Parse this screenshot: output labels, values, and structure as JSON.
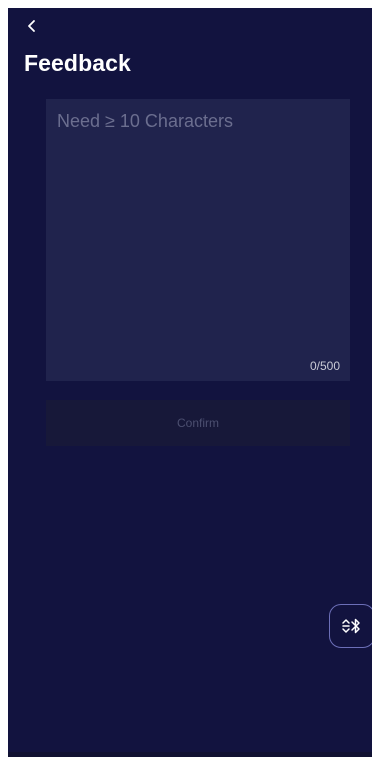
{
  "header": {
    "back_icon": "chevron-left-icon",
    "title": "Feedback"
  },
  "feedback": {
    "placeholder": "Need ≥ 10 Characters",
    "value": "",
    "counter": "0/500"
  },
  "actions": {
    "confirm_label": "Confirm",
    "confirm_enabled": false
  },
  "floating": {
    "icon": "bluetooth-connection-icon"
  },
  "colors": {
    "background": "#12133f",
    "input_background": "#20234d",
    "button_background": "#171839",
    "floating_border": "#6c6fb8",
    "title_text": "#ffffff"
  }
}
